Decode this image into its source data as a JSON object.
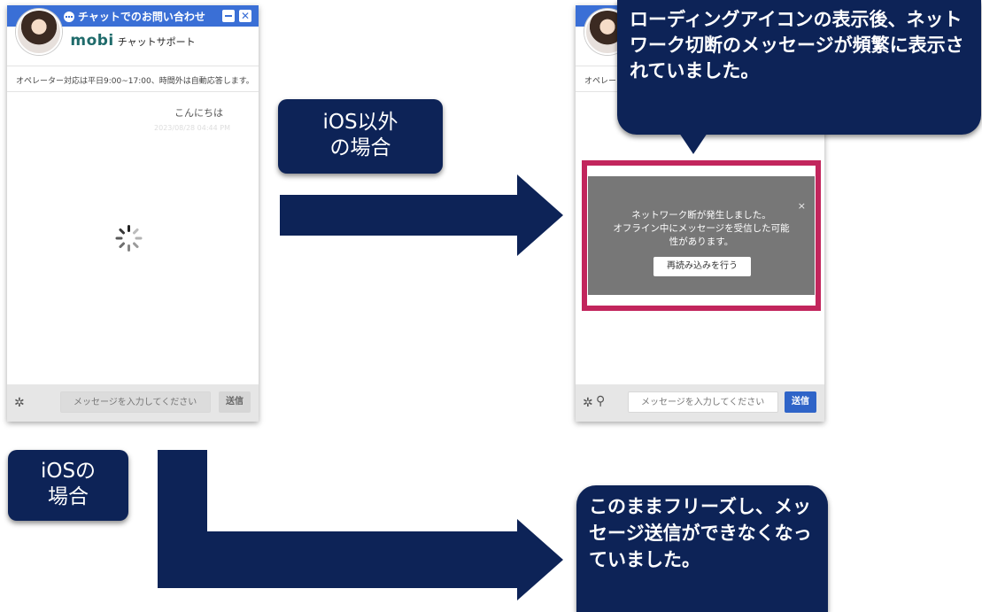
{
  "widget": {
    "title": "チャットでのお問い合わせ",
    "close_glyph": "✕",
    "brand_logo": "mobi",
    "brand_subtitle": "チャットサポート",
    "notice": "オペレーター対応は平日9:00~17:00、時間外は自動応答します。",
    "greeting": "こんにちは",
    "timestamp": "2023/08/28 04:44 PM",
    "input_placeholder": "メッセージを入力してください",
    "send_label": "送信",
    "notice_truncated": "オペレー"
  },
  "error_dialog": {
    "message": "ネットワーク断が発生しました。\nオフライン中にメッセージを受信した可能\n性があります。",
    "close_glyph": "×",
    "reload_label": "再読み込みを行う"
  },
  "annotations": {
    "non_ios_label": "iOS以外\nの場合",
    "ios_label": "iOSの\n場合",
    "non_ios_result": "ローディングアイコンの表示後、ネットワーク切断のメッセージが頻繁に表示されていました。",
    "ios_result": "このままフリーズし、メッセージ送信ができなくなっていました。"
  },
  "colors": {
    "title_bar": "#3a6fd6",
    "callout_navy": "#0d2357",
    "error_frame": "#c2255c",
    "send_active": "#2f64c8"
  }
}
